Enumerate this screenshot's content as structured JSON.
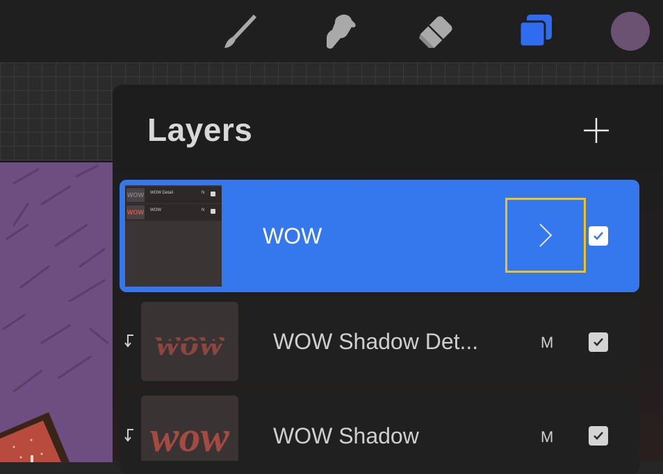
{
  "toolbar": {
    "tools": [
      {
        "icon": "brush-icon"
      },
      {
        "icon": "smudge-icon"
      },
      {
        "icon": "eraser-icon"
      },
      {
        "icon": "layers-icon",
        "active": true
      },
      {
        "icon": "color-swatch-icon",
        "color": "#6b5273"
      }
    ],
    "accent": "#2f6cf0"
  },
  "panel": {
    "title": "Layers",
    "add_icon": "plus-icon"
  },
  "layers": [
    {
      "name": "WOW",
      "type": "group",
      "selected": true,
      "visible": true,
      "expand_icon": "chevron-right-icon",
      "preview": [
        {
          "thumb": "WOW",
          "name": "WOW Detail",
          "mode": "N"
        },
        {
          "thumb": "WOW",
          "name": "WOW",
          "mode": "N"
        }
      ]
    },
    {
      "name": "WOW Shadow Det...",
      "blend_mode": "M",
      "clipped": true,
      "visible": true
    },
    {
      "name": "WOW Shadow",
      "blend_mode": "M",
      "clipped": true,
      "visible": true
    }
  ],
  "colors": {
    "selected_row": "#3577ed",
    "highlight_box": "#f2c31b"
  }
}
